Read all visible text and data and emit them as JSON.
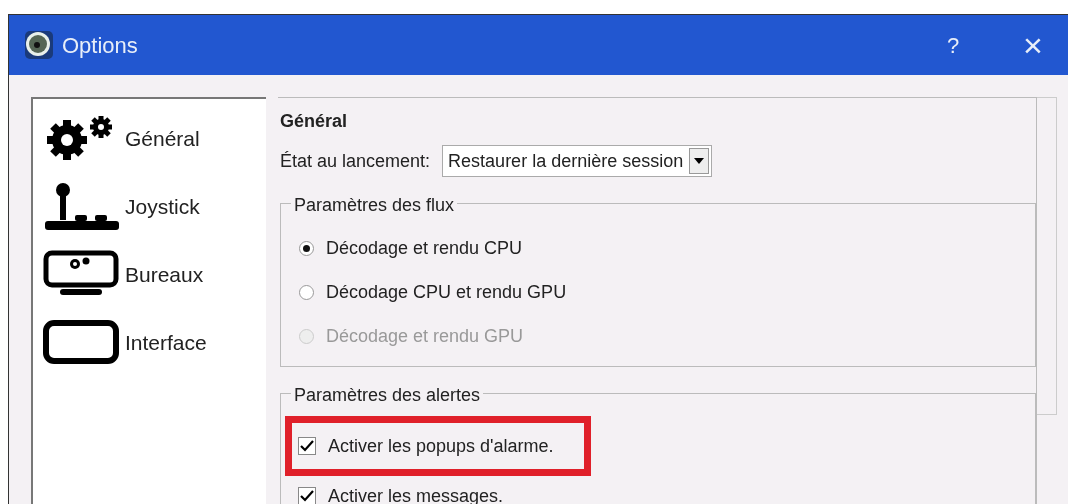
{
  "window": {
    "title": "Options",
    "help_button": "?",
    "close_button": "×"
  },
  "sidebar": {
    "items": [
      {
        "label": "Général",
        "kind": "gears",
        "selected": false
      },
      {
        "label": "Joystick",
        "kind": "joystick",
        "selected": false
      },
      {
        "label": "Bureaux",
        "kind": "monitor",
        "selected": false
      },
      {
        "label": "Interface",
        "kind": "frame",
        "selected": false
      }
    ]
  },
  "content": {
    "heading": "Général",
    "startup": {
      "label": "État au lancement:",
      "value": "Restaurer la dernière session"
    },
    "stream_group": {
      "title": "Paramètres des flux",
      "options": [
        {
          "label": "Décodage et rendu CPU",
          "selected": true,
          "disabled": false
        },
        {
          "label": "Décodage CPU et rendu GPU",
          "selected": false,
          "disabled": false
        },
        {
          "label": "Décodage et rendu GPU",
          "selected": false,
          "disabled": true
        }
      ]
    },
    "alerts_group": {
      "title": "Paramètres des alertes",
      "options": [
        {
          "label": "Activer les popups d'alarme.",
          "checked": true,
          "highlighted": true
        },
        {
          "label": "Activer les messages.",
          "checked": true,
          "highlighted": false
        }
      ]
    }
  }
}
